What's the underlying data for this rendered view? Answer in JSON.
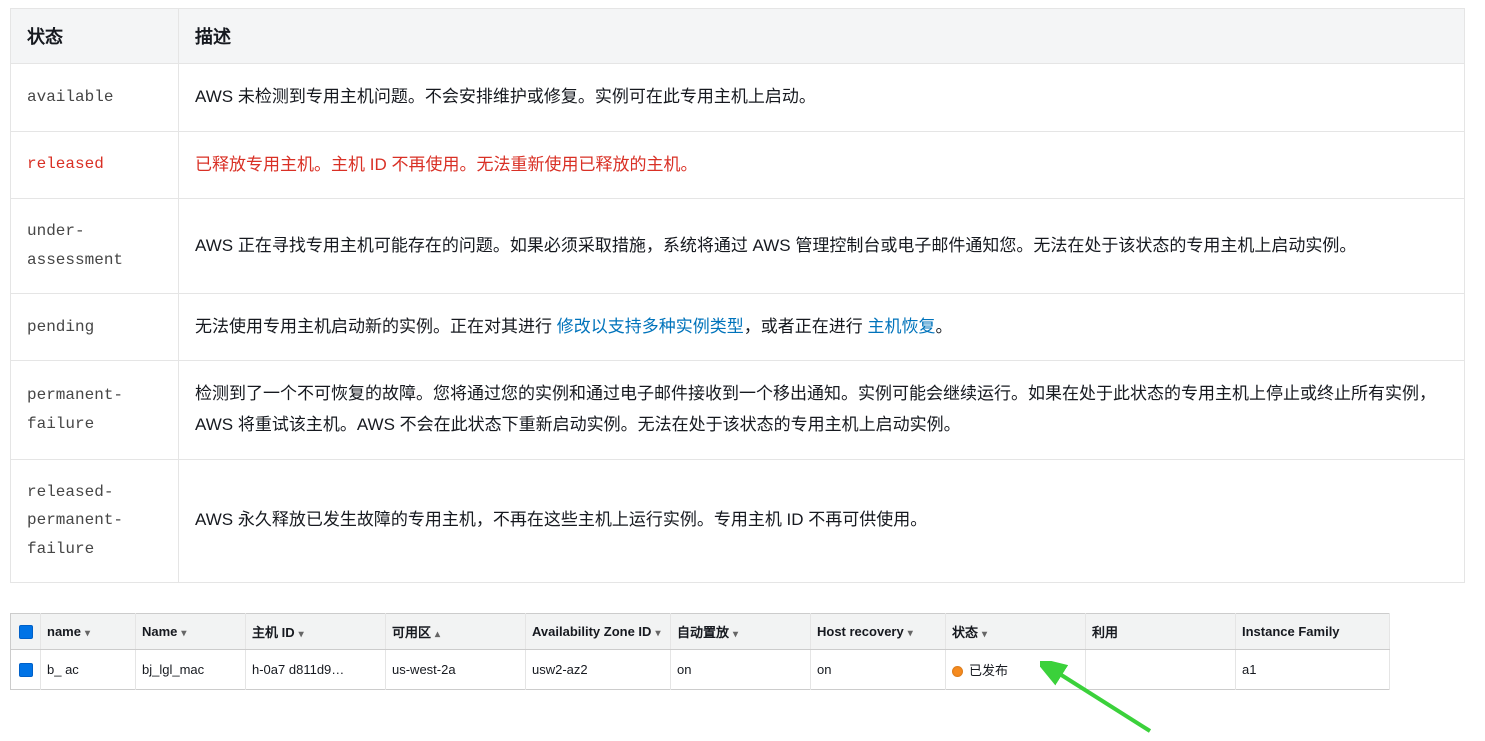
{
  "status_table": {
    "headers": {
      "state": "状态",
      "desc": "描述"
    },
    "rows": [
      {
        "state": "available",
        "desc": "AWS 未检测到专用主机问题。不会安排维护或修复。实例可在此专用主机上启动。"
      },
      {
        "state": "released",
        "desc": "已释放专用主机。主机 ID 不再使用。无法重新使用已释放的主机。",
        "red": true
      },
      {
        "state": "under-assessment",
        "desc": "AWS 正在寻找专用主机可能存在的问题。如果必须采取措施，系统将通过 AWS 管理控制台或电子邮件通知您。无法在处于该状态的专用主机上启动实例。"
      },
      {
        "state": "pending",
        "desc_pre": "无法使用专用主机启动新的实例。正在对其进行 ",
        "link1": "修改以支持多种实例类型",
        "desc_mid": "，或者正在进行 ",
        "link2": "主机恢复",
        "desc_post": "。"
      },
      {
        "state": "permanent-failure",
        "desc": "检测到了一个不可恢复的故障。您将通过您的实例和通过电子邮件接收到一个移出通知。实例可能会继续运行。如果在处于此状态的专用主机上停止或终止所有实例，AWS 将重试该主机。AWS 不会在此状态下重新启动实例。无法在处于该状态的专用主机上启动实例。"
      },
      {
        "state": "released-permanent-failure",
        "desc": "AWS 永久释放已发生故障的专用主机，不再在这些主机上运行实例。专用主机 ID 不再可供使用。"
      }
    ]
  },
  "grid": {
    "headers": {
      "name_lc": "name",
      "name_uc": "Name",
      "host_id": "主机 ID",
      "az": "可用区",
      "az_id": "Availability Zone ID",
      "auto_place": "自动置放",
      "host_recovery": "Host recovery",
      "state": "状态",
      "util": "利用",
      "instance_family": "Instance Family"
    },
    "row": {
      "name_lc": "b_      ac",
      "name_uc": "bj_lgl_mac",
      "host_id": "h-0a7        d811d9…",
      "az": "us-west-2a",
      "az_id": "usw2-az2",
      "auto_place": "on",
      "host_recovery": "on",
      "state": "已发布",
      "util": "",
      "instance_family": "a1"
    }
  }
}
